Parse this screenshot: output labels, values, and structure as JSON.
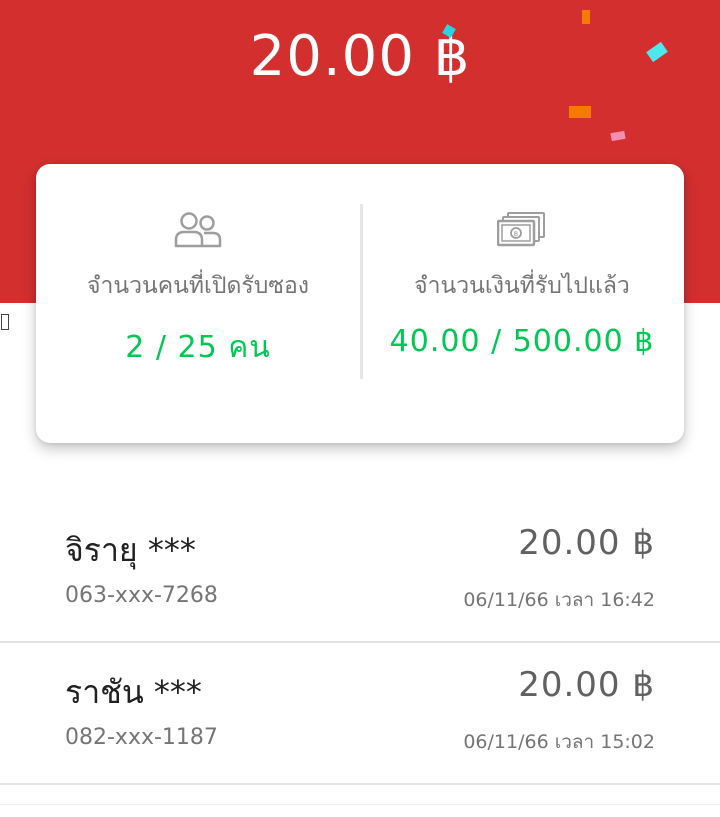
{
  "header": {
    "amount": "20.00 ฿",
    "background_color": "#d32f2f"
  },
  "summary": {
    "participants": {
      "icon": "people-icon",
      "label": "จำนวนคนที่เปิดรับซอง",
      "value": "2 / 25 คน"
    },
    "money": {
      "icon": "banknote-icon",
      "label": "จำนวนเงินที่รับไปแล้ว",
      "value": "40.00 / 500.00 ฿"
    },
    "value_color": "#00c853"
  },
  "recipients": [
    {
      "name": "จิรายุ ***",
      "phone": "063-xxx-7268",
      "amount": "20.00 ฿",
      "time": "06/11/66 เวลา 16:42"
    },
    {
      "name": "ราชัน ***",
      "phone": "082-xxx-1187",
      "amount": "20.00 ฿",
      "time": "06/11/66 เวลา 15:02"
    }
  ]
}
